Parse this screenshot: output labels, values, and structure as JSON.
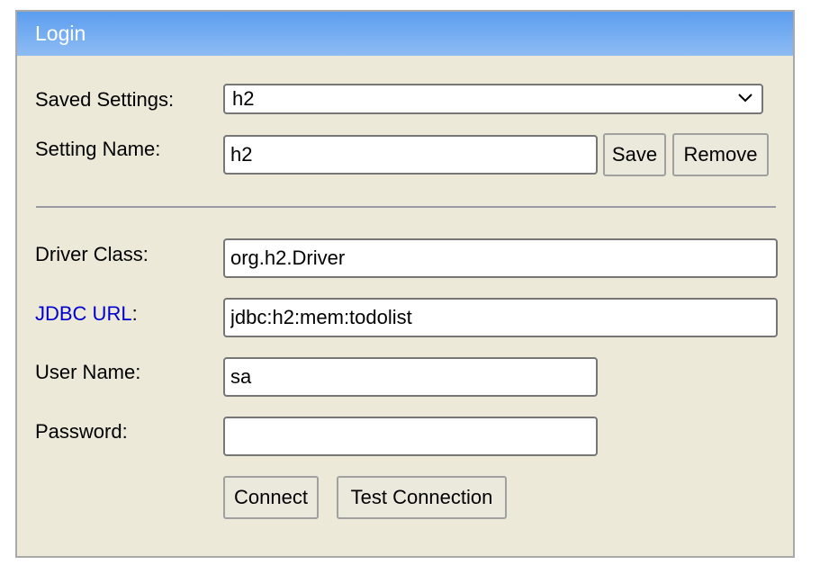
{
  "window": {
    "title": "Login"
  },
  "settings": {
    "saved_label": "Saved Settings:",
    "saved_value": "h2",
    "name_label": "Setting Name:",
    "name_value": "h2",
    "save_label": "Save",
    "remove_label": "Remove"
  },
  "connection": {
    "driver_label": "Driver Class:",
    "driver_value": "org.h2.Driver",
    "jdbc_label": "JDBC URL",
    "jdbc_suffix": ":",
    "jdbc_value": "jdbc:h2:mem:todolist",
    "user_label": "User Name:",
    "user_value": "sa",
    "password_label": "Password:",
    "password_value": ""
  },
  "actions": {
    "connect_label": "Connect",
    "test_label": "Test Connection"
  },
  "icons": {
    "dropdown": "chevron-down-icon"
  },
  "colors": {
    "title_bar_start": "#5c9df0",
    "title_bar_end": "#8ebcf3",
    "panel_background": "#ece9d8",
    "link": "#0000cc"
  }
}
